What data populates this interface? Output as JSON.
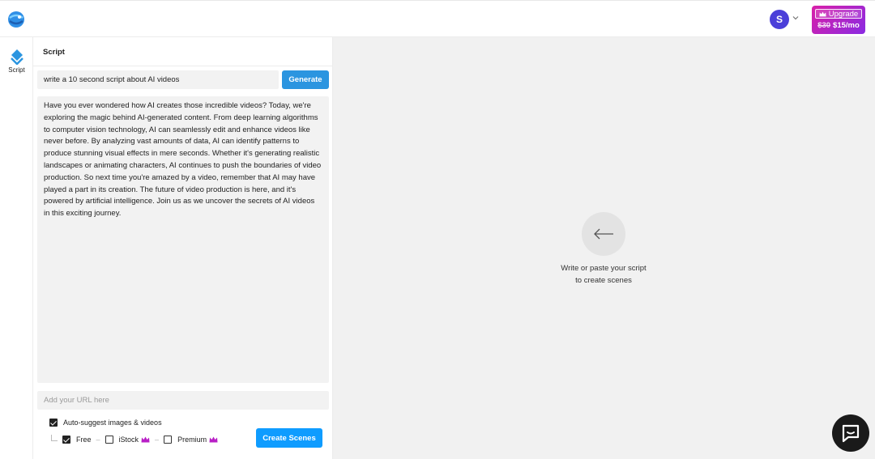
{
  "header": {
    "avatar_initial": "S",
    "upgrade": {
      "label": "Upgrade",
      "old_price": "$30",
      "new_price": "$15/mo"
    }
  },
  "rail": {
    "items": [
      {
        "label": "Script",
        "icon": "script-icon"
      }
    ]
  },
  "panel": {
    "title": "Script",
    "prompt_value": "write a 10 second script about AI videos",
    "generate_label": "Generate",
    "script_text": "Have you ever wondered how AI creates those incredible videos? Today, we're exploring the magic behind AI-generated content. From deep learning algorithms to computer vision technology, AI can seamlessly edit and enhance videos like never before. By analyzing vast amounts of data, AI can identify patterns to produce stunning visual effects in mere seconds. Whether it's generating realistic landscapes or animating characters, AI continues to push the boundaries of video production. So next time you're amazed by a video, remember that AI may have played a part in its creation. The future of video production is here, and it's powered by artificial intelligence. Join us as we uncover the secrets of AI videos in this exciting journey.",
    "url_placeholder": "Add your URL here",
    "auto_suggest_label": "Auto-suggest images & videos",
    "sources": [
      {
        "label": "Free",
        "checked": true,
        "premium": false
      },
      {
        "label": "iStock",
        "checked": false,
        "premium": true
      },
      {
        "label": "Premium",
        "checked": false,
        "premium": true
      }
    ],
    "create_label": "Create Scenes"
  },
  "canvas": {
    "empty_line1": "Write or paste your script",
    "empty_line2": "to create scenes"
  },
  "colors": {
    "accent_blue": "#2b95e0",
    "create_blue": "#0f9cff",
    "avatar_purple": "#4b3fd9",
    "upgrade_pink": "#d91fa8",
    "crown_purple": "#b81fc6"
  }
}
